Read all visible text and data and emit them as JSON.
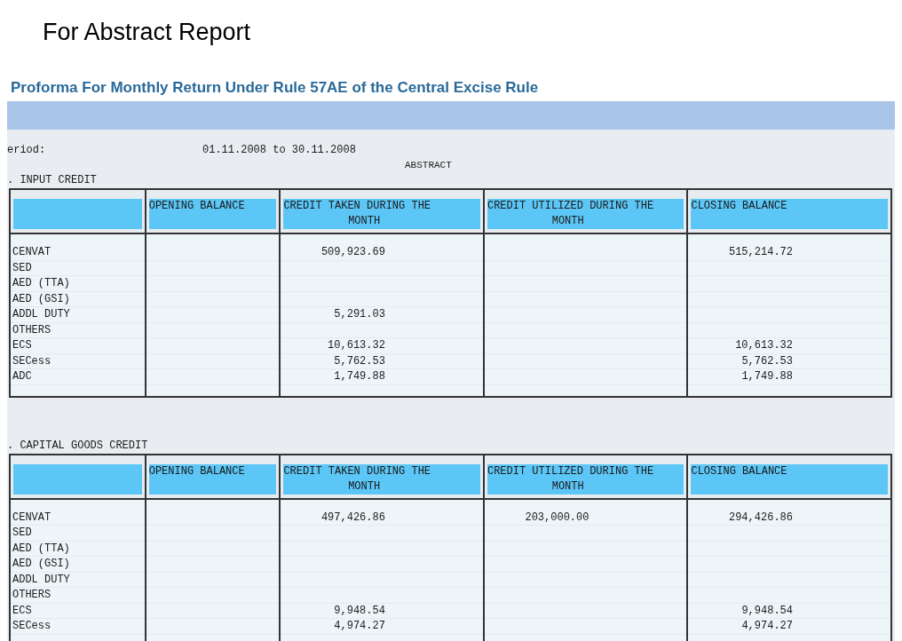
{
  "slide_title": "For Abstract Report",
  "report_title": "Proforma For Monthly Return Under Rule 57AE of the Central Excise Rule",
  "period": {
    "label": "eriod:",
    "value": "01.11.2008 to 30.11.2008"
  },
  "abstract_label": "ABSTRACT",
  "sections": [
    {
      "title": ". INPUT CREDIT",
      "columns": [
        [
          "OPENING BALANCE"
        ],
        [
          "CREDIT TAKEN DURING THE",
          "MONTH"
        ],
        [
          "CREDIT UTILIZED DURING THE",
          "MONTH"
        ],
        [
          "CLOSING BALANCE"
        ]
      ],
      "rows": [
        {
          "label": "CENVAT",
          "values": {
            "credit_taken": "509,923.69",
            "closing_balance": "515,214.72"
          }
        },
        {
          "label": "SED"
        },
        {
          "label": "AED (TTA)"
        },
        {
          "label": "AED (GSI)"
        },
        {
          "label": "ADDL DUTY",
          "values": {
            "credit_taken": "5,291.03"
          }
        },
        {
          "label": "OTHERS"
        },
        {
          "label": "ECS",
          "values": {
            "credit_taken": "10,613.32",
            "closing_balance": "10,613.32"
          }
        },
        {
          "label": "SECess",
          "values": {
            "credit_taken": "5,762.53",
            "closing_balance": "5,762.53"
          }
        },
        {
          "label": "ADC",
          "values": {
            "credit_taken": "1,749.88",
            "closing_balance": "1,749.88"
          }
        }
      ]
    },
    {
      "title": ". CAPITAL GOODS CREDIT",
      "columns": [
        [
          "OPENING BALANCE"
        ],
        [
          "CREDIT TAKEN DURING THE",
          "MONTH"
        ],
        [
          "CREDIT UTILIZED DURING THE",
          "MONTH"
        ],
        [
          "CLOSING BALANCE"
        ]
      ],
      "rows": [
        {
          "label": "CENVAT",
          "values": {
            "credit_taken": "497,426.86",
            "credit_utilized": "203,000.00",
            "closing_balance": "294,426.86"
          }
        },
        {
          "label": "SED"
        },
        {
          "label": "AED (TTA)"
        },
        {
          "label": "AED (GSI)"
        },
        {
          "label": "ADDL DUTY"
        },
        {
          "label": "OTHERS"
        },
        {
          "label": "ECS",
          "values": {
            "credit_taken": "9,948.54",
            "closing_balance": "9,948.54"
          }
        },
        {
          "label": "SECess",
          "values": {
            "credit_taken": "4,974.27",
            "closing_balance": "4,974.27"
          }
        }
      ]
    }
  ]
}
